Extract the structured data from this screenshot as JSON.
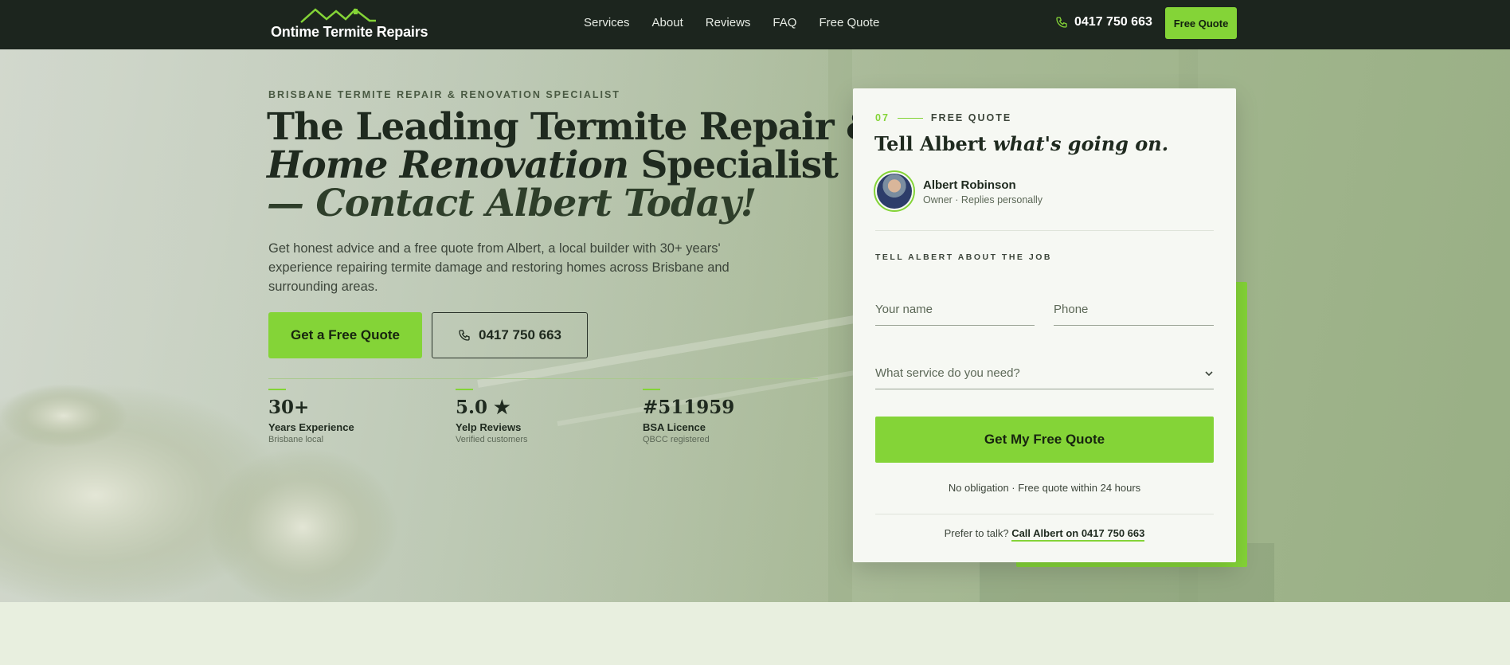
{
  "nav": {
    "brand": "Ontime Termite Repairs",
    "links": [
      "Services",
      "About",
      "Reviews",
      "FAQ",
      "Free Quote"
    ],
    "phone": "0417 750 663",
    "cta": "Free Quote"
  },
  "hero": {
    "eyebrow": "BRISBANE TERMITE REPAIR & RENOVATION SPECIALIST",
    "headline_1": "The Leading Termite Repair &",
    "headline_2_em": "Home Renovation",
    "headline_2_rest": " Specialist",
    "headline_3": "— Contact Albert Today!",
    "lede": "Get honest advice and a free quote from Albert, a local builder with 30+ years' experience repairing termite damage and restoring homes across Brisbane and surrounding areas.",
    "primary_cta": "Get a Free Quote",
    "phone_cta": "0417 750 663"
  },
  "stats": [
    {
      "num": "30+",
      "label": "Years Experience",
      "sub": "Brisbane local"
    },
    {
      "num": "5.0 ★",
      "label": "Yelp Reviews",
      "sub": "Verified customers"
    },
    {
      "num": "#511959",
      "label": "BSA Licence",
      "sub": "QBCC registered"
    }
  ],
  "card": {
    "step_num": "07",
    "step_title": "FREE QUOTE",
    "title_plain": "Tell Albert ",
    "title_em": "what's going on.",
    "owner_name": "Albert Robinson",
    "owner_sub": "Owner · Replies personally",
    "job_label": "TELL ALBERT ABOUT THE JOB",
    "name_placeholder": "Your name",
    "phone_placeholder": "Phone",
    "service_placeholder": "What service do you need?",
    "submit": "Get My Free Quote",
    "fineprint": "No obligation · Free quote within 24 hours",
    "talk_prefix": "Prefer to talk? ",
    "talk_link": "Call Albert on 0417 750 663"
  },
  "colors": {
    "accent": "#84d437",
    "nav_bg": "#1c251e",
    "text_dark": "#1f2a1f"
  }
}
